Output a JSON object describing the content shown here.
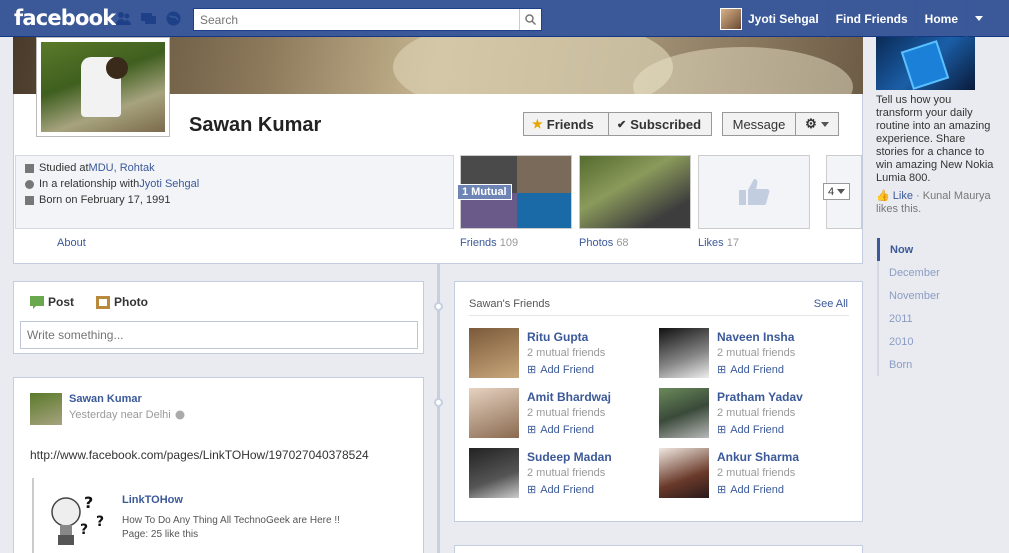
{
  "topbar": {
    "logo": "facebook",
    "search_placeholder": "Search",
    "user_name": "Jyoti Sehgal",
    "find_friends": "Find Friends",
    "home": "Home"
  },
  "profile": {
    "name": "Sawan Kumar",
    "buttons": {
      "friends": "Friends",
      "subscribed": "Subscribed",
      "message": "Message"
    },
    "info": {
      "studied_prefix": "Studied at ",
      "studied_at": "MDU, Rohtak",
      "relationship_prefix": "In a relationship with ",
      "relationship_with": "Jyoti Sehgal",
      "born": "Born on February 17, 1991"
    },
    "about_label": "About",
    "tiles": {
      "mutual_badge": "1 Mutual",
      "friends_label": "Friends",
      "friends_count": "109",
      "photos_label": "Photos",
      "photos_count": "68",
      "likes_label": "Likes",
      "likes_count": "17",
      "more_count": "4"
    }
  },
  "composer": {
    "post_tab": "Post",
    "photo_tab": "Photo",
    "placeholder": "Write something..."
  },
  "post": {
    "author": "Sawan Kumar",
    "meta": "Yesterday near Delhi",
    "url": "http://www.facebook.com/pages/LinkTOHow/197027040378524",
    "preview": {
      "title": "LinkTOHow",
      "description": "How To Do Any Thing All TechnoGeek are Here !!",
      "likes": "Page: 25 like this"
    }
  },
  "friends_card": {
    "title": "Sawan's Friends",
    "see_all": "See All",
    "add_label": "Add Friend",
    "friends": [
      {
        "name": "Ritu Gupta",
        "mutual": "2 mutual friends"
      },
      {
        "name": "Naveen Insha",
        "mutual": "2 mutual friends"
      },
      {
        "name": "Amit Bhardwaj",
        "mutual": "2 mutual friends"
      },
      {
        "name": "Pratham Yadav",
        "mutual": "2 mutual friends"
      },
      {
        "name": "Sudeep Madan",
        "mutual": "2 mutual friends"
      },
      {
        "name": "Ankur Sharma",
        "mutual": "2 mutual friends"
      }
    ]
  },
  "sidebar": {
    "ad_text": "Tell us how you transform your daily routine into an amazing experience. Share stories for a chance to win amazing New Nokia Lumia 800.",
    "ad_like_link": "Like",
    "ad_like_rest": " · Kunal Maurya likes this.",
    "scrubber": [
      "Now",
      "December",
      "November",
      "2011",
      "2010",
      "Born"
    ]
  },
  "colors": {
    "brand": "#3b5998",
    "background": "#e9ebf1"
  }
}
